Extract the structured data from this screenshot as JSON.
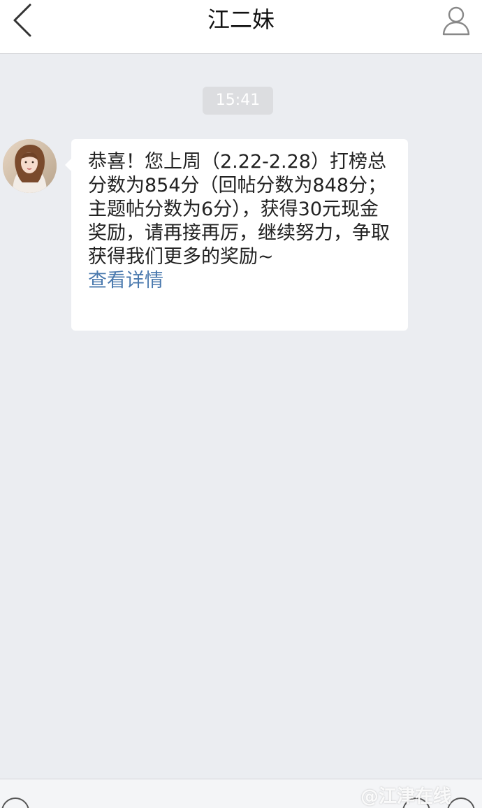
{
  "header": {
    "title": "江二妹",
    "back_icon": "chevron-left-icon",
    "profile_icon": "person-icon"
  },
  "chat": {
    "timestamp": "15:41",
    "messages": [
      {
        "avatar": "avatar-photo",
        "text": "恭喜！您上周（2.22-2.28）打榜总分数为854分（回帖分数为848分；主题帖分数为6分），获得30元现金奖励，请再接再厉，继续努力，争取获得我们更多的奖励~",
        "link_label": "查看详情"
      }
    ]
  },
  "watermark": "@江津在线",
  "colors": {
    "background": "#ebedf1",
    "bubble": "#ffffff",
    "link": "#4a79ae",
    "timestamp_bg": "#dcdde0"
  }
}
